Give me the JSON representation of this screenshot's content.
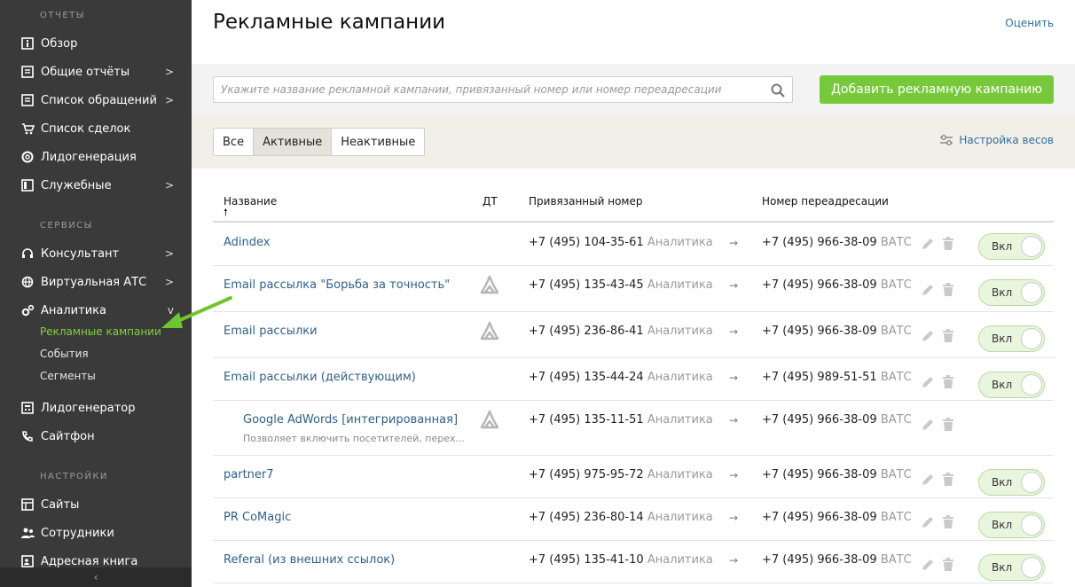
{
  "sidebar": {
    "sections": {
      "reports": "ОТЧЕТЫ",
      "services": "СЕРВИСЫ",
      "settings": "НАСТРОЙКИ"
    },
    "items": [
      {
        "label": "Обзор",
        "icon": "info-icon"
      },
      {
        "label": "Общие отчёты",
        "icon": "report-icon",
        "chevron": ">"
      },
      {
        "label": "Список обращений",
        "icon": "list-icon",
        "chevron": ">"
      },
      {
        "label": "Список сделок",
        "icon": "cart-icon"
      },
      {
        "label": "Лидогенерация",
        "icon": "lifebuoy-icon"
      },
      {
        "label": "Служебные",
        "icon": "panel-icon",
        "chevron": ">"
      },
      {
        "label": "Консультант",
        "icon": "headset-icon",
        "chevron": ">"
      },
      {
        "label": "Виртуальная АТС",
        "icon": "globe-icon",
        "chevron": ">"
      },
      {
        "label": "Аналитика",
        "icon": "gears-icon",
        "chevron": "v"
      },
      {
        "label": "Лидогенератор",
        "icon": "calculator-icon"
      },
      {
        "label": "Сайтфон",
        "icon": "phone-icon"
      },
      {
        "label": "Сайты",
        "icon": "grid-icon"
      },
      {
        "label": "Сотрудники",
        "icon": "people-icon"
      },
      {
        "label": "Адресная книга",
        "icon": "addressbook-icon"
      }
    ],
    "subitems": [
      {
        "label": "Рекламные кампании",
        "active": true
      },
      {
        "label": "События"
      },
      {
        "label": "Сегменты"
      }
    ],
    "collapse": "‹"
  },
  "header": {
    "title": "Рекламные кампании",
    "rate_link": "Оценить"
  },
  "search": {
    "placeholder": "Укажите название рекламной кампании, привязанный номер или номер переадресации",
    "add_button": "Добавить рекламную кампанию"
  },
  "filters": {
    "all": "Все",
    "active": "Активные",
    "inactive": "Неактивные",
    "weights": "Настройка весов"
  },
  "table": {
    "columns": {
      "name": "Название",
      "dt": "ДТ",
      "bound": "Привязанный номер",
      "redirect": "Номер переадресации"
    },
    "sort_indicator": "🠕",
    "rows": [
      {
        "name": "Adindex",
        "dt": false,
        "bound": "+7 (495) 104-35-61",
        "bound_tag": "Аналитика",
        "redirect": "+7 (495) 966-38-09",
        "redirect_tag": "ВАТС",
        "toggle": "Вкл"
      },
      {
        "name": "Email рассылка \"Борьба за точность\"",
        "dt": true,
        "bound": "+7 (495) 135-43-45",
        "bound_tag": "Аналитика",
        "redirect": "+7 (495) 966-38-09",
        "redirect_tag": "ВАТС",
        "toggle": "Вкл"
      },
      {
        "name": "Email рассылки",
        "dt": true,
        "bound": "+7 (495) 236-86-41",
        "bound_tag": "Аналитика",
        "redirect": "+7 (495) 966-38-09",
        "redirect_tag": "ВАТС",
        "toggle": "Вкл"
      },
      {
        "name": "Email рассылки (действующим)",
        "dt": false,
        "bound": "+7 (495) 135-44-24",
        "bound_tag": "Аналитика",
        "redirect": "+7 (495) 989-51-51",
        "redirect_tag": "ВАТС",
        "toggle": "Вкл"
      },
      {
        "name": "Google AdWords [интегрированная]",
        "description": "Позволяет включить посетителей, перех...",
        "dt": true,
        "bound": "+7 (495) 135-11-51",
        "bound_tag": "Аналитика",
        "redirect": "+7 (495) 966-38-09",
        "redirect_tag": "ВАТС",
        "toggle": ""
      },
      {
        "name": "partner7",
        "dt": false,
        "bound": "+7 (495) 975-95-72",
        "bound_tag": "Аналитика",
        "redirect": "+7 (495) 966-38-09",
        "redirect_tag": "ВАТС",
        "toggle": "Вкл"
      },
      {
        "name": "PR CoMagic",
        "dt": false,
        "bound": "+7 (495) 236-80-14",
        "bound_tag": "Аналитика",
        "redirect": "+7 (495) 966-38-09",
        "redirect_tag": "ВАТС",
        "toggle": "Вкл"
      },
      {
        "name": "Referal (из внешних ссылок)",
        "dt": false,
        "bound": "+7 (495) 135-41-10",
        "bound_tag": "Аналитика",
        "redirect": "+7 (495) 966-38-09",
        "redirect_tag": "ВАТС",
        "toggle": "Вкл"
      }
    ],
    "arrow_glyph": "→"
  },
  "colors": {
    "sidebar_bg": "#3a3a3a",
    "accent_green": "#77c93b",
    "link_blue": "#2e5f8a",
    "active_sub": "#7fd13b"
  }
}
